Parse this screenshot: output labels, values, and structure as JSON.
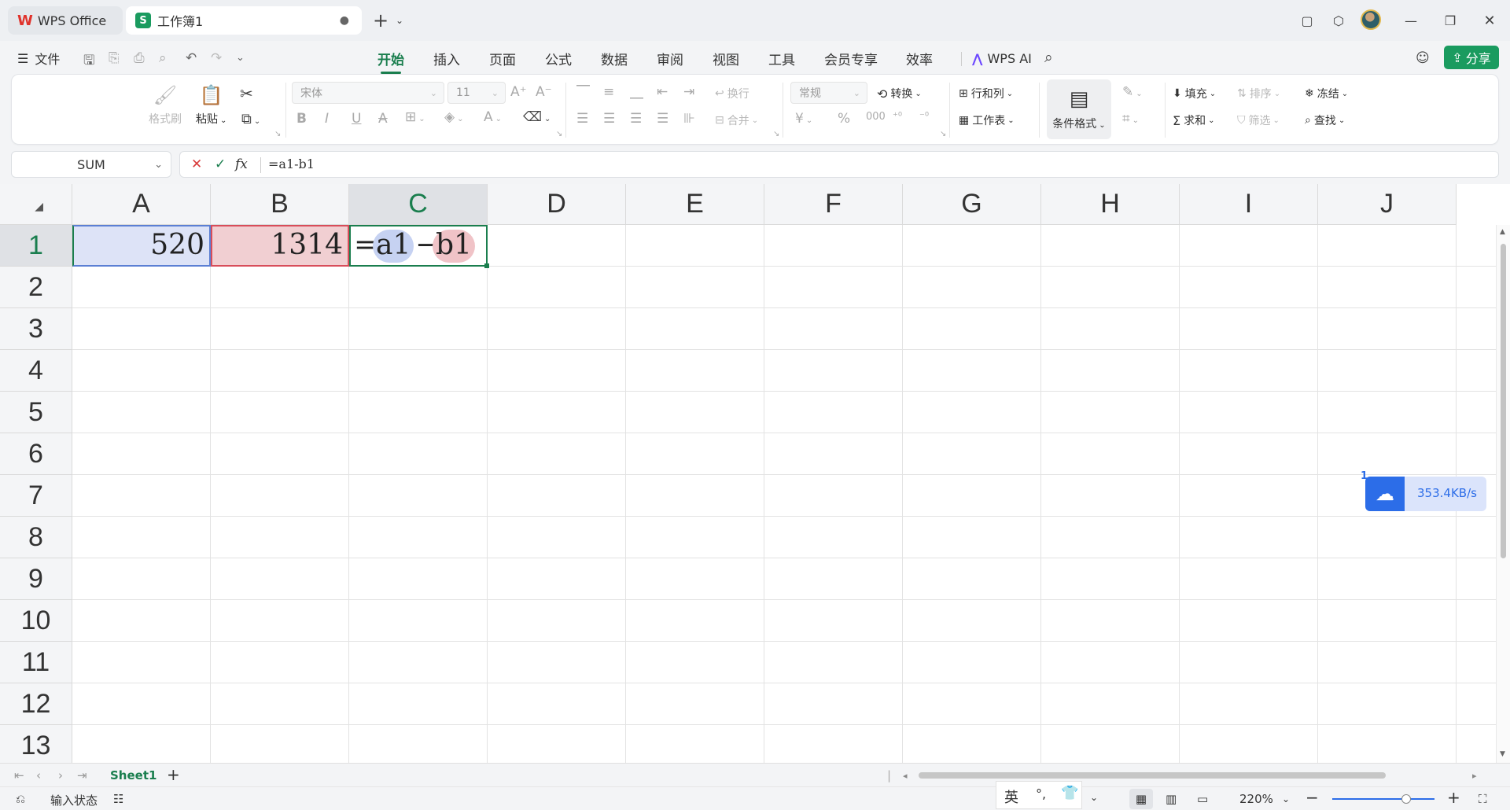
{
  "titlebar": {
    "tabs": [
      {
        "label": "WPS Office"
      },
      {
        "label": "工作簿1"
      }
    ],
    "new_tab": "+"
  },
  "menu": {
    "file": "文件",
    "tabs": [
      "开始",
      "插入",
      "页面",
      "公式",
      "数据",
      "审阅",
      "视图",
      "工具",
      "会员专享",
      "效率"
    ],
    "active_tab": "开始",
    "wps_ai": "WPS AI",
    "share": "分享"
  },
  "ribbon": {
    "format_painter": "格式刷",
    "paste": "粘贴",
    "font_name": "宋体",
    "font_size": "11",
    "wrap": "换行",
    "merge": "合并",
    "number_format": "常规",
    "convert": "转换",
    "row_col": "行和列",
    "worksheet": "工作表",
    "cond_format": "条件格式",
    "fill": "填充",
    "sort": "排序",
    "freeze": "冻结",
    "sum": "求和",
    "filter": "筛选",
    "find": "查找"
  },
  "formula_bar": {
    "name_box": "SUM",
    "cancel": "✕",
    "confirm": "✓",
    "fx": "fx",
    "formula": "=a1-b1"
  },
  "grid": {
    "columns": [
      "A",
      "B",
      "C",
      "D",
      "E",
      "F",
      "G",
      "H",
      "I",
      "J"
    ],
    "rows": [
      "1",
      "2",
      "3",
      "4",
      "5",
      "6",
      "7",
      "8",
      "9",
      "10",
      "11",
      "12",
      "13"
    ],
    "cells": {
      "A1": "520",
      "B1": "1314",
      "C1_eq": "=",
      "C1_ref1": "a1",
      "C1_op": "−",
      "C1_ref2": "b1"
    }
  },
  "upload_widget": {
    "badge": "1",
    "speed": "353.4KB/s"
  },
  "sheets": {
    "active": "Sheet1",
    "add": "+"
  },
  "status": {
    "mode": "输入状态",
    "ime": "英",
    "zoom": "220%"
  },
  "colors": {
    "accent": "#1a7e4e",
    "ref_blue": "#dde3f7",
    "ref_red": "#f1cfd2",
    "ai_purple": "#6c47ff"
  }
}
